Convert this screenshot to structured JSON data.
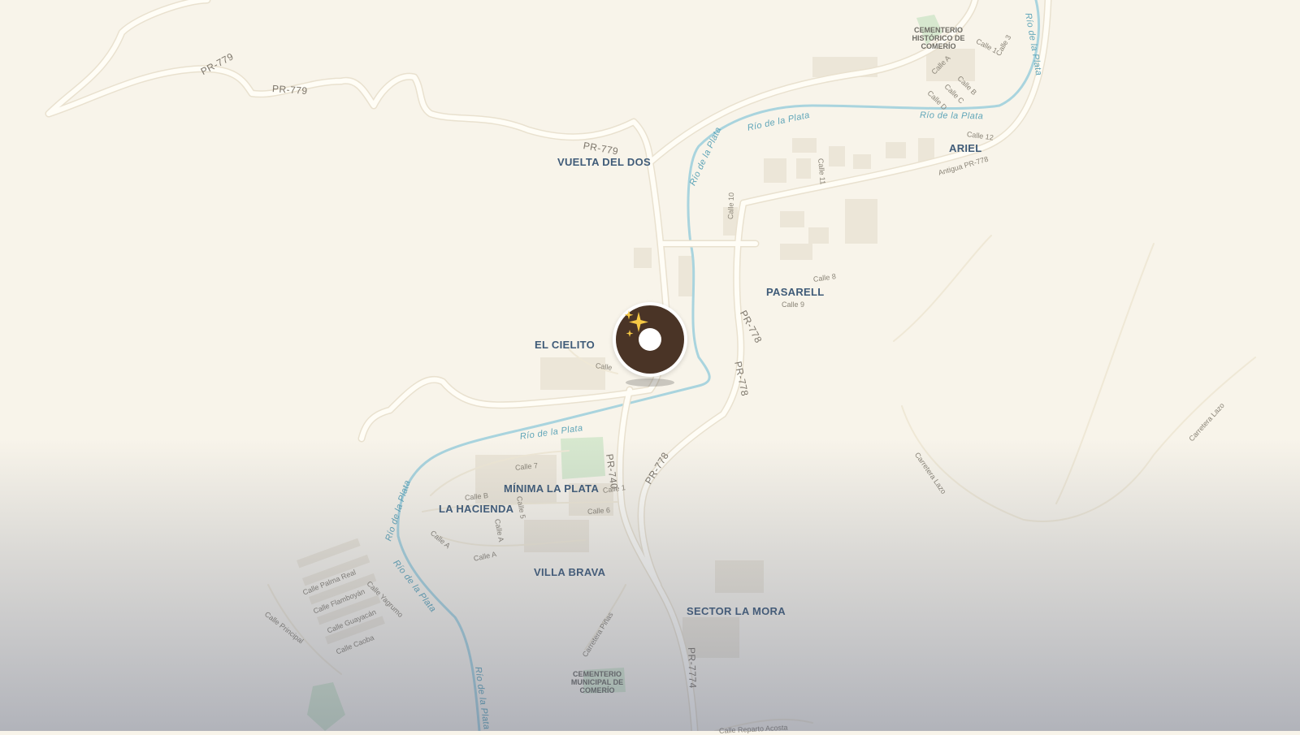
{
  "places": {
    "vuelta_del_dos": "VUELTA DEL DOS",
    "ariel": "ARIEL",
    "pasarell": "PASARELL",
    "el_cielito": "EL CIELITO",
    "minima_la_plata": "MÍNIMA LA PLATA",
    "la_hacienda": "LA HACIENDA",
    "villa_brava": "VILLA BRAVA",
    "sector_la_mora": "SECTOR LA MORA"
  },
  "pois": {
    "cemetery_historic": "CEMENTERIO HISTÓRICO DE COMERÍO",
    "cemetery_municipal": "CEMENTERIO MUNICIPAL DE COMERÍO"
  },
  "routes": {
    "pr779_a": "PR-779",
    "pr779_b": "PR-779",
    "pr779_c": "PR-779",
    "pr778_a": "PR-778",
    "pr778_b": "PR-778",
    "pr778_c": "PR-778",
    "pr740": "PR-740",
    "pr7774": "PR-7774",
    "antigua_pr778": "Antigua PR-778"
  },
  "rivers": {
    "r1": "Río de la Plata",
    "r2": "Río de la Plata",
    "r3": "Río de la Plata",
    "r4": "Río de la Plata",
    "r5": "Río de la Plata",
    "r6": "Río de la Plata",
    "r7": "Río de la Plata",
    "r8": "Río de la Plata"
  },
  "streets": {
    "calle1_ne": "Calle 1",
    "calle3_ne": "Calle 3",
    "calleA_ne": "Calle A",
    "calleB_ne": "Calle B",
    "calleC_ne": "Calle C",
    "calleD_ne": "Calle D",
    "calle12": "Calle 12",
    "calle11": "Calle 11",
    "calle10": "Calle 10",
    "calle8": "Calle 8",
    "calle9": "Calle 9",
    "calle_cielito": "Calle",
    "calle7": "Calle 7",
    "calleB_s": "Calle B",
    "calle1_s": "Calle 1",
    "calle5": "Calle 5",
    "calle6": "Calle 6",
    "calleA_s1": "Calle A",
    "calleA_s2": "Calle A",
    "calleA_s3": "Calle A",
    "palma_real": "Calle Palma Real",
    "flamboyan": "Calle Flamboyán",
    "yagrumo": "Calle Yagrumo",
    "guayacan": "Calle Guayacán",
    "caoba": "Calle Caoba",
    "principal": "Calle Principal",
    "carretera_pinas": "Carretera Piñas",
    "carretera_lazo_1": "Carretera Lazo",
    "carretera_lazo_2": "Carretera Lazo",
    "reparto_acosta": "Calle Reparto Acosta"
  },
  "colors": {
    "land": "#f8f4ea",
    "road": "#fffdf6",
    "road_casing": "#e9e1cf",
    "river": "#a9d4de",
    "building": "#ece6d8",
    "park": "#d7e8cf",
    "marker": "#4a3426"
  },
  "marker": {
    "icon": "sparkles-icon"
  }
}
